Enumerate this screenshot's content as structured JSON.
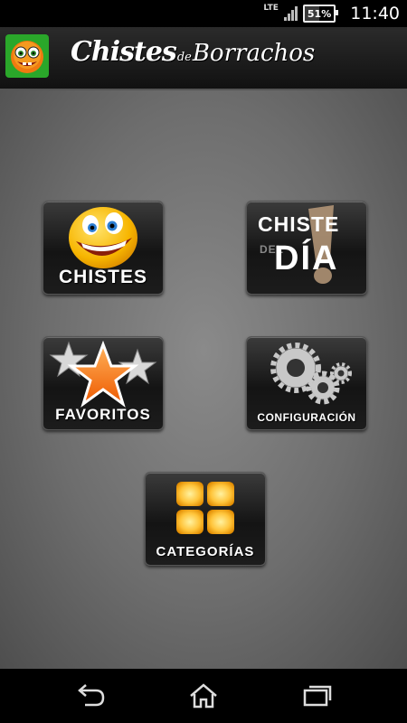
{
  "status_bar": {
    "network": "LTE",
    "battery_percent": "51%",
    "battery_level": 0.51,
    "time": "11:40"
  },
  "header": {
    "title_main": "Chistes",
    "title_de": "de",
    "title_second": "Borrachos",
    "icon": "drunk-face-icon"
  },
  "menu": {
    "chistes": {
      "label": "CHISTES",
      "icon": "smiley-face-icon"
    },
    "chiste_del_dia": {
      "line1": "CHISTE",
      "line2": "DEL",
      "line3": "DÍA",
      "icon": "exclamation-icon"
    },
    "favoritos": {
      "label": "FAVORITOS",
      "icon": "stars-icon"
    },
    "configuracion": {
      "label": "CONFIGURACIÓN",
      "icon": "gears-icon"
    },
    "categorias": {
      "label": "CATEGORÍAS",
      "icon": "grid-tiles-icon"
    }
  },
  "nav": {
    "back_icon": "back-icon",
    "home_icon": "home-icon",
    "recents_icon": "recents-icon"
  },
  "colors": {
    "header_bg": "#1a1a1a",
    "tile_bg": "#222222",
    "accent_orange": "#f5a200",
    "app_icon_green": "#2aa72a"
  }
}
